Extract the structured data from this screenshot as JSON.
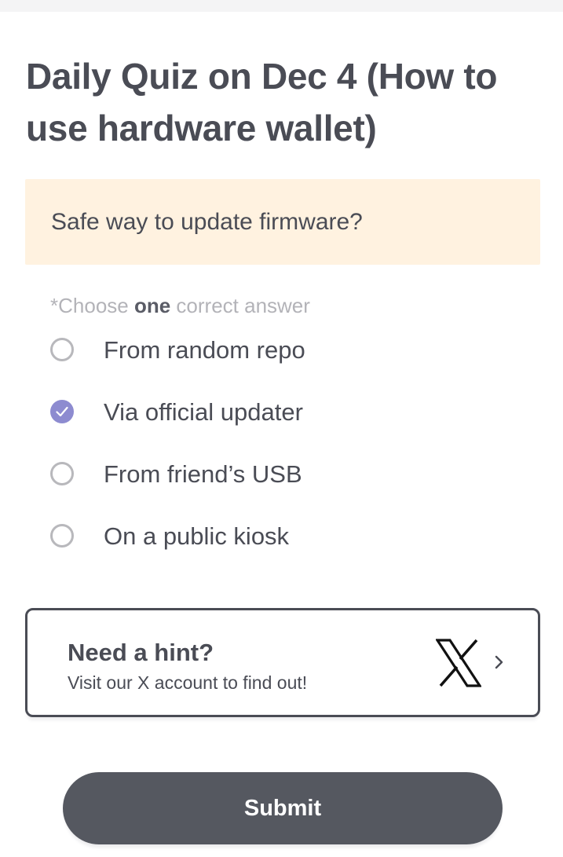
{
  "page": {
    "title": "Daily Quiz on Dec 4 (How to use hardware wallet)"
  },
  "question": {
    "text": "Safe way to update firmware?"
  },
  "instruction": {
    "prefix": "*Choose ",
    "emphasis": "one",
    "suffix": " correct answer"
  },
  "options": [
    {
      "label": "From random repo",
      "selected": false
    },
    {
      "label": "Via official updater",
      "selected": true
    },
    {
      "label": "From friend’s USB",
      "selected": false
    },
    {
      "label": "On a public kiosk",
      "selected": false
    }
  ],
  "hint": {
    "title": "Need a hint?",
    "subtitle": "Visit our X account to find out!",
    "icon": "x-logo-icon",
    "arrow_icon": "chevron-right-icon"
  },
  "submit": {
    "label": "Submit"
  },
  "colors": {
    "text": "#4a4c55",
    "question_bg": "#fff2e0",
    "radio_selected": "#8d8bd0",
    "radio_border": "#b8b8bc",
    "submit_bg": "#555860"
  }
}
